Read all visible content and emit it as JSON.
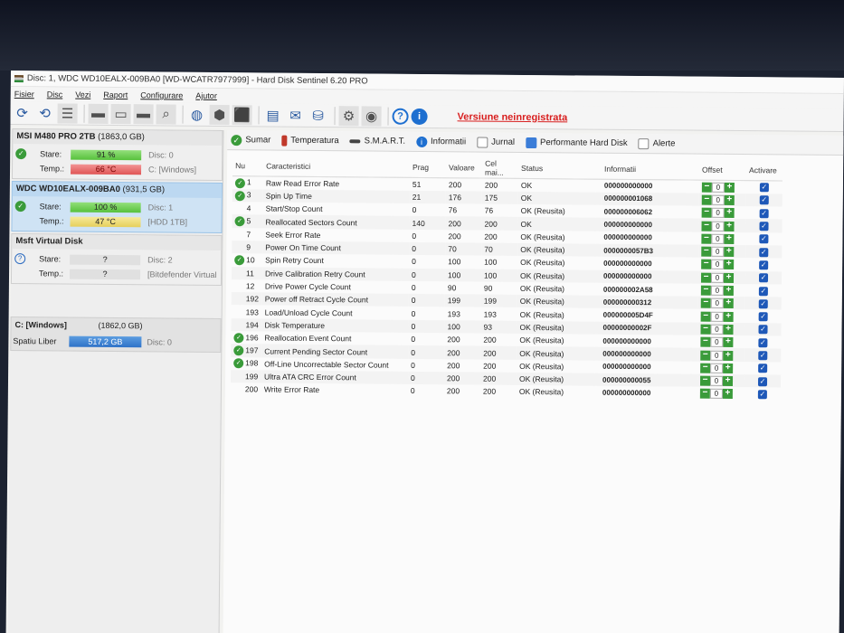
{
  "window": {
    "title": "Disc: 1, WDC WD10EALX-009BA0 [WD-WCATR7977999]  -  Hard Disk Sentinel 6.20 PRO"
  },
  "menu": [
    "Fisier",
    "Disc",
    "Vezi",
    "Raport",
    "Configurare",
    "Ajutor"
  ],
  "toolbar": {
    "unregistered": "Versiune neinregistrata"
  },
  "disks": [
    {
      "name": "MSI M480 PRO 2TB",
      "size": "(1863,0 GB)",
      "stare_label": "Stare:",
      "stare": "91 %",
      "stare_side": "Disc: 0",
      "temp_label": "Temp.:",
      "temp": "66 °C",
      "temp_side": "C: [Windows]"
    },
    {
      "name": "WDC WD10EALX-009BA0",
      "size": "(931,5 GB)",
      "stare_label": "Stare:",
      "stare": "100 %",
      "stare_side": "Disc: 1",
      "temp_label": "Temp.:",
      "temp": "47 °C",
      "temp_side": "[HDD 1TB]"
    },
    {
      "name": "Msft   Virtual Disk",
      "size": "",
      "stare_label": "Stare:",
      "stare": "?",
      "stare_side": "Disc: 2",
      "temp_label": "Temp.:",
      "temp": "?",
      "temp_side": "[Bitdefender Virtual"
    }
  ],
  "partition": {
    "name": "C: [Windows]",
    "size": "(1862,0 GB)",
    "free_label": "Spatiu Liber",
    "free": "517,2 GB",
    "disc": "Disc: 0"
  },
  "tabs": [
    "Sumar",
    "Temperatura",
    "S.M.A.R.T.",
    "Informatii",
    "Jurnal",
    "Performante Hard Disk",
    "Alerte"
  ],
  "smart": {
    "headers": [
      "Nu",
      "Caracteristici",
      "Prag",
      "Valoare",
      "Cel mai...",
      "Status",
      "Informatii",
      "Offset",
      "Activare"
    ],
    "rows": [
      {
        "nu": "1",
        "ok": true,
        "name": "Raw Read Error Rate",
        "prag": "51",
        "val": "200",
        "cel": "200",
        "status": "OK",
        "info": "000000000000",
        "offset": "0"
      },
      {
        "nu": "3",
        "ok": true,
        "name": "Spin Up Time",
        "prag": "21",
        "val": "176",
        "cel": "175",
        "status": "OK",
        "info": "000000001068",
        "offset": "0"
      },
      {
        "nu": "4",
        "ok": false,
        "name": "Start/Stop Count",
        "prag": "0",
        "val": "76",
        "cel": "76",
        "status": "OK (Reusita)",
        "info": "000000006062",
        "offset": "0"
      },
      {
        "nu": "5",
        "ok": true,
        "name": "Reallocated Sectors Count",
        "prag": "140",
        "val": "200",
        "cel": "200",
        "status": "OK",
        "info": "000000000000",
        "offset": "0"
      },
      {
        "nu": "7",
        "ok": false,
        "name": "Seek Error Rate",
        "prag": "0",
        "val": "200",
        "cel": "200",
        "status": "OK (Reusita)",
        "info": "000000000000",
        "offset": "0"
      },
      {
        "nu": "9",
        "ok": false,
        "name": "Power On Time Count",
        "prag": "0",
        "val": "70",
        "cel": "70",
        "status": "OK (Reusita)",
        "info": "0000000057B3",
        "offset": "0"
      },
      {
        "nu": "10",
        "ok": true,
        "name": "Spin Retry Count",
        "prag": "0",
        "val": "100",
        "cel": "100",
        "status": "OK (Reusita)",
        "info": "000000000000",
        "offset": "0"
      },
      {
        "nu": "11",
        "ok": false,
        "name": "Drive Calibration Retry Count",
        "prag": "0",
        "val": "100",
        "cel": "100",
        "status": "OK (Reusita)",
        "info": "000000000000",
        "offset": "0"
      },
      {
        "nu": "12",
        "ok": false,
        "name": "Drive Power Cycle Count",
        "prag": "0",
        "val": "90",
        "cel": "90",
        "status": "OK (Reusita)",
        "info": "000000002A58",
        "offset": "0"
      },
      {
        "nu": "192",
        "ok": false,
        "name": "Power off Retract Cycle Count",
        "prag": "0",
        "val": "199",
        "cel": "199",
        "status": "OK (Reusita)",
        "info": "000000000312",
        "offset": "0"
      },
      {
        "nu": "193",
        "ok": false,
        "name": "Load/Unload Cycle Count",
        "prag": "0",
        "val": "193",
        "cel": "193",
        "status": "OK (Reusita)",
        "info": "000000005D4F",
        "offset": "0"
      },
      {
        "nu": "194",
        "ok": false,
        "name": "Disk Temperature",
        "prag": "0",
        "val": "100",
        "cel": "93",
        "status": "OK (Reusita)",
        "info": "00000000002F",
        "offset": "0"
      },
      {
        "nu": "196",
        "ok": true,
        "name": "Reallocation Event Count",
        "prag": "0",
        "val": "200",
        "cel": "200",
        "status": "OK (Reusita)",
        "info": "000000000000",
        "offset": "0"
      },
      {
        "nu": "197",
        "ok": true,
        "name": "Current Pending Sector Count",
        "prag": "0",
        "val": "200",
        "cel": "200",
        "status": "OK (Reusita)",
        "info": "000000000000",
        "offset": "0"
      },
      {
        "nu": "198",
        "ok": true,
        "name": "Off-Line Uncorrectable Sector Count",
        "prag": "0",
        "val": "200",
        "cel": "200",
        "status": "OK (Reusita)",
        "info": "000000000000",
        "offset": "0"
      },
      {
        "nu": "199",
        "ok": false,
        "name": "Ultra ATA CRC Error Count",
        "prag": "0",
        "val": "200",
        "cel": "200",
        "status": "OK (Reusita)",
        "info": "000000000055",
        "offset": "0"
      },
      {
        "nu": "200",
        "ok": false,
        "name": "Write Error Rate",
        "prag": "0",
        "val": "200",
        "cel": "200",
        "status": "OK (Reusita)",
        "info": "000000000000",
        "offset": "0"
      }
    ]
  }
}
